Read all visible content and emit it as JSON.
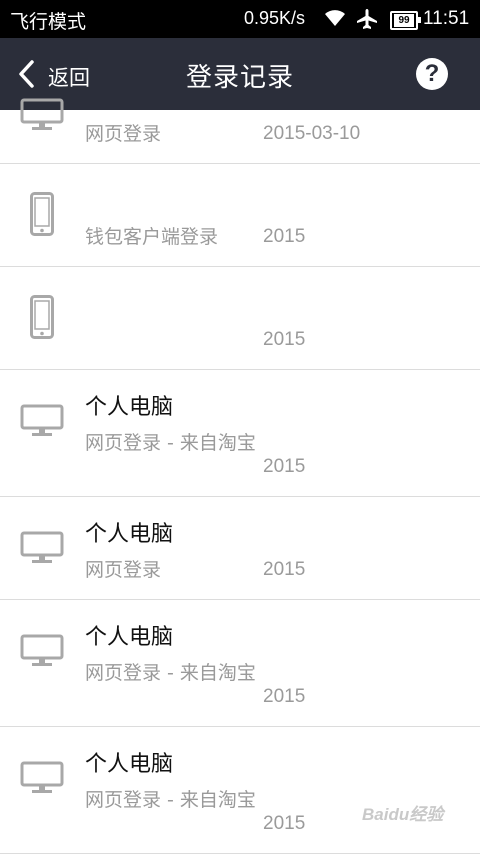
{
  "status_bar": {
    "mode": "飞行模式",
    "speed": "0.95K/s",
    "battery": "99",
    "time": "11:51"
  },
  "app_bar": {
    "back_label": "返回",
    "title": "登录记录",
    "help_icon": "?"
  },
  "records": [
    {
      "device_icon": "desktop-icon",
      "name": "",
      "method": "网页登录",
      "date": "2015-03-10"
    },
    {
      "device_icon": "phone-icon",
      "name": "",
      "method": "钱包客户端登录",
      "date": "2015"
    },
    {
      "device_icon": "phone-icon",
      "name": "",
      "method": "",
      "date": "2015"
    },
    {
      "device_icon": "desktop-icon",
      "name": "个人电脑",
      "method": "网页登录 - 来自淘宝",
      "date": "2015"
    },
    {
      "device_icon": "desktop-icon",
      "name": "个人电脑",
      "method": "网页登录",
      "date": "2015"
    },
    {
      "device_icon": "desktop-icon",
      "name": "个人电脑",
      "method": "网页登录 - 来自淘宝",
      "date": "2015"
    },
    {
      "device_icon": "desktop-icon",
      "name": "个人电脑",
      "method": "网页登录 - 来自淘宝",
      "date": "2015"
    }
  ],
  "watermark": "Baidu经验",
  "colors": {
    "app_bar_bg": "#2b2e3a",
    "status_bar_bg": "#000000",
    "secondary_text": "#9a9a9a",
    "icon_gray": "#a8a8a8"
  }
}
